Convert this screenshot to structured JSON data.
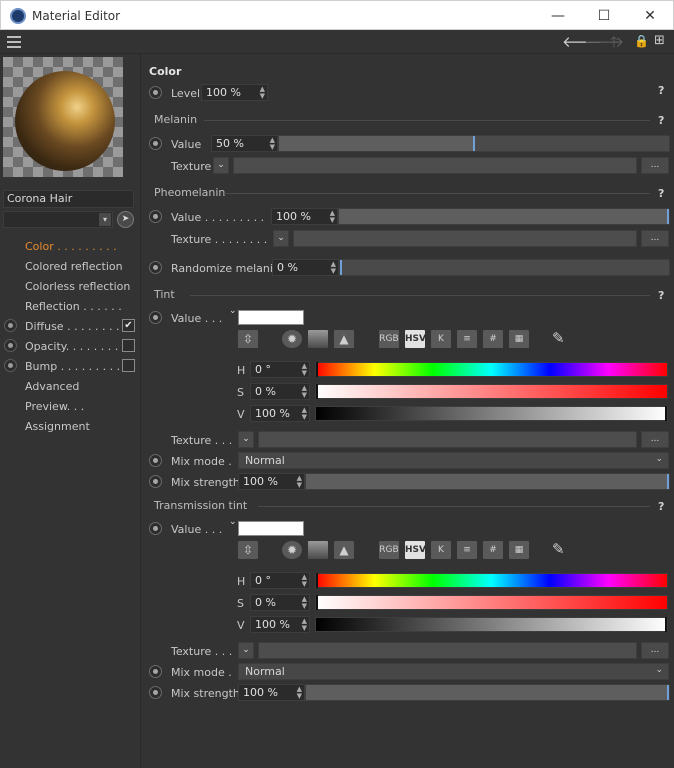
{
  "window": {
    "title": "Material Editor",
    "minimize": "—",
    "maximize": "☐",
    "close": "✕"
  },
  "toolbar": {
    "back": "🡐",
    "forward": "🡒",
    "up": "🡑",
    "lock": "🔒",
    "new": "⊞"
  },
  "left": {
    "material_name": "Corona Hair",
    "nav": [
      {
        "label": "Color . . . . . . . . .",
        "active": true,
        "radio": false,
        "check": null
      },
      {
        "label": "Colored reflection",
        "active": false,
        "radio": false,
        "check": null
      },
      {
        "label": "Colorless reflection",
        "active": false,
        "radio": false,
        "check": null
      },
      {
        "label": "Reflection . . . . . .",
        "active": false,
        "radio": false,
        "check": null
      },
      {
        "label": "Diffuse . . . . . . . .",
        "active": false,
        "radio": true,
        "check": true
      },
      {
        "label": "Opacity. . . . . . . .",
        "active": false,
        "radio": true,
        "check": false
      },
      {
        "label": "Bump . . . . . . . . .",
        "active": false,
        "radio": true,
        "check": false
      },
      {
        "label": "Advanced",
        "active": false,
        "radio": false,
        "check": null
      },
      {
        "label": "Preview. . .",
        "active": false,
        "radio": false,
        "check": null
      },
      {
        "label": "Assignment",
        "active": false,
        "radio": false,
        "check": null
      }
    ]
  },
  "main": {
    "section_title": "Color",
    "help": "?",
    "level": {
      "label": "Level",
      "value": "100 %"
    },
    "melanin": {
      "header": "Melanin",
      "value_label": "Value",
      "value": "50 %",
      "level": 0.5,
      "texture_label": "Texture",
      "more": "..."
    },
    "pheomelanin": {
      "header": "Pheomelanin",
      "value_label": "Value . . . . . . . . .",
      "value": "100 %",
      "level": 1.0,
      "texture_label": "Texture . . . . . . . .",
      "more": "...",
      "randomize_label": "Randomize melanin",
      "randomize_value": "0 %",
      "randomize_level": 0.0
    },
    "tint": {
      "header": "Tint",
      "value_label": "Value . . .",
      "swatch_color": "#ffffff",
      "tools": [
        "RGB",
        "HSV",
        "K",
        "≡",
        "#",
        "▦"
      ],
      "h_label": "H",
      "h_value": "0 °",
      "s_label": "S",
      "s_value": "0 %",
      "v_label": "V",
      "v_value": "100 %",
      "texture_label": "Texture . . .",
      "more": "...",
      "mix_mode_label": "Mix mode .",
      "mix_mode_value": "Normal",
      "mix_strength_label": "Mix strength",
      "mix_strength_value": "100 %",
      "mix_strength_level": 1.0
    },
    "transmission": {
      "header": "Transmission tint",
      "value_label": "Value . . .",
      "swatch_color": "#ffffff",
      "tools": [
        "RGB",
        "HSV",
        "K",
        "≡",
        "#",
        "▦"
      ],
      "h_label": "H",
      "h_value": "0 °",
      "s_label": "S",
      "s_value": "0 %",
      "v_label": "V",
      "v_value": "100 %",
      "texture_label": "Texture . . .",
      "more": "...",
      "mix_mode_label": "Mix mode .",
      "mix_mode_value": "Normal",
      "mix_strength_label": "Mix strength",
      "mix_strength_value": "100 %",
      "mix_strength_level": 1.0
    }
  }
}
